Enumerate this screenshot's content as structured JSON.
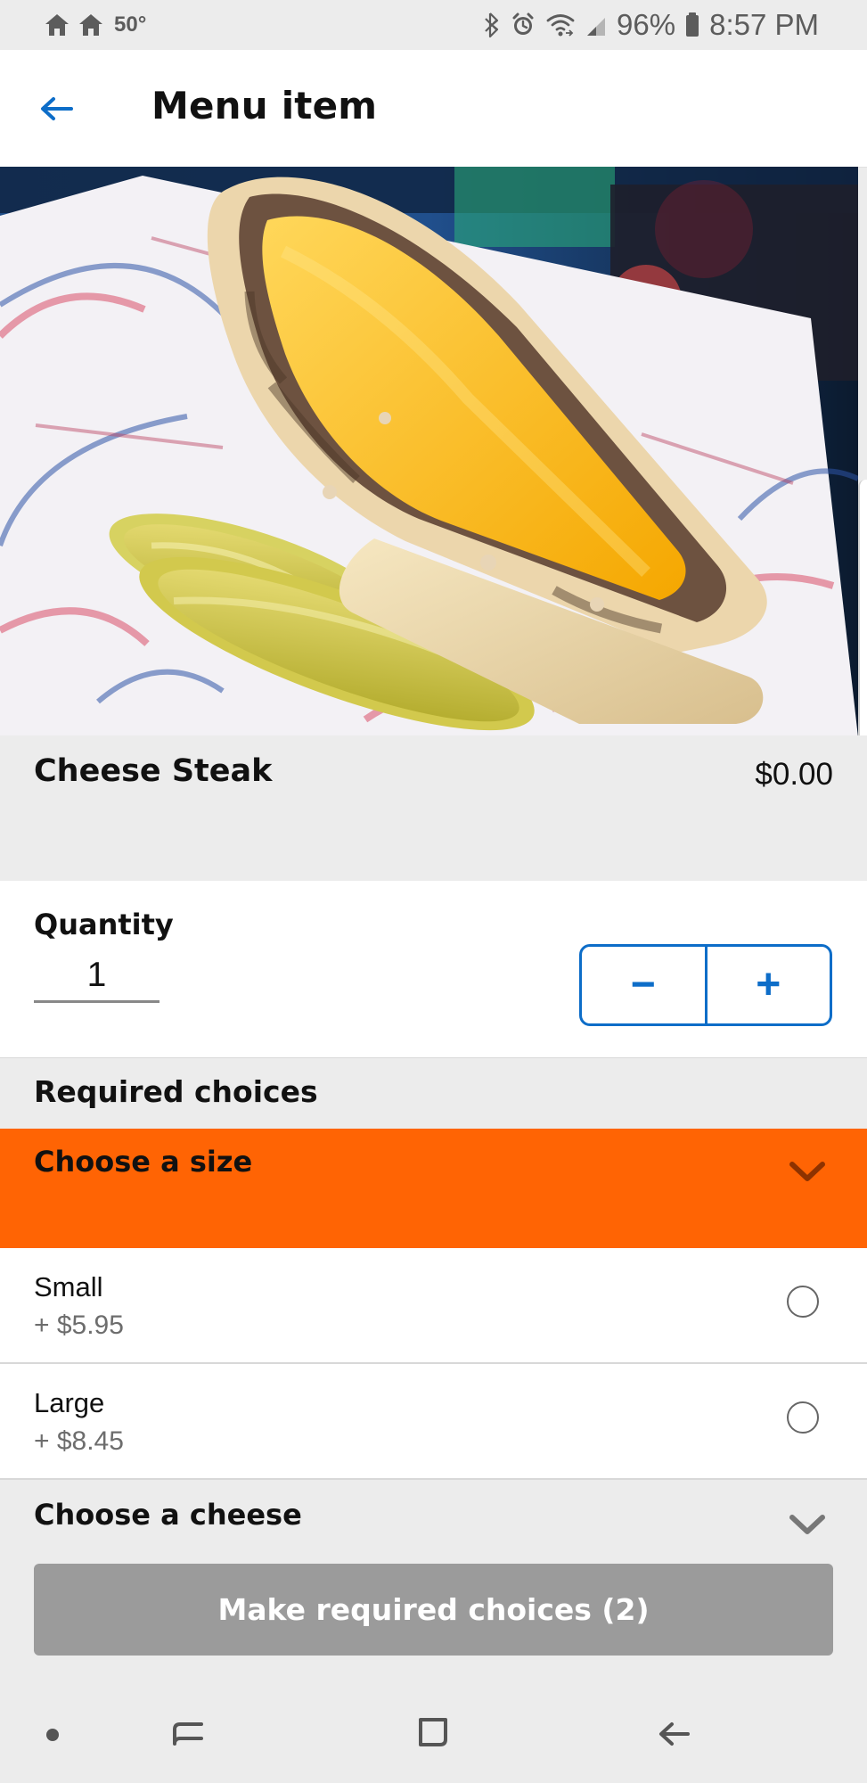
{
  "status_bar": {
    "temperature": "50°",
    "battery": "96%",
    "time": "8:57 PM"
  },
  "header": {
    "title": "Menu item"
  },
  "item": {
    "name": "Cheese Steak",
    "price": "$0.00"
  },
  "quantity": {
    "label": "Quantity",
    "value": "1",
    "decrement_label": "−",
    "increment_label": "+"
  },
  "required_choices": {
    "title": "Required choices",
    "size": {
      "title": "Choose a size",
      "options": [
        {
          "name": "Small",
          "price": "+ $5.95"
        },
        {
          "name": "Large",
          "price": "+ $8.45"
        }
      ]
    },
    "cheese": {
      "title": "Choose a cheese"
    }
  },
  "cta": {
    "label": "Make required choices (2)"
  },
  "colors": {
    "accent_blue": "#0d6dc8",
    "highlight_orange": "#ff6404",
    "background_gray": "#ececec",
    "button_gray": "#9b9b9b"
  },
  "icons": {
    "status": [
      "home-icon",
      "home-icon",
      "bluetooth-icon",
      "alarm-icon",
      "wifi-icon",
      "signal-icon",
      "battery-icon"
    ],
    "navigation": [
      "back-arrow-icon",
      "chevron-down-icon",
      "radio-button-icon",
      "recent-apps-icon",
      "home-square-icon",
      "android-back-icon"
    ]
  }
}
